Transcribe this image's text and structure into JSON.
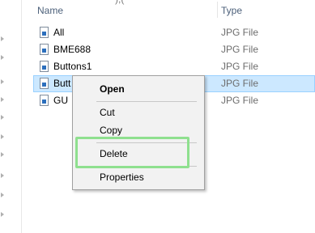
{
  "header": {
    "crumb_fragment": "),(",
    "column_name": "Name",
    "column_type": "Type"
  },
  "files": [
    {
      "name": "All",
      "type": "JPG File"
    },
    {
      "name": "BME688",
      "type": "JPG File"
    },
    {
      "name": "Buttons1",
      "type": "JPG File"
    },
    {
      "name": "Butt",
      "type": "JPG File"
    },
    {
      "name": "GU",
      "type": "JPG File"
    }
  ],
  "context_menu": {
    "open": "Open",
    "cut": "Cut",
    "copy": "Copy",
    "delete": "Delete",
    "properties": "Properties"
  },
  "colors": {
    "selection_bg": "#cce8ff",
    "highlight_box": "#8fe08f"
  }
}
